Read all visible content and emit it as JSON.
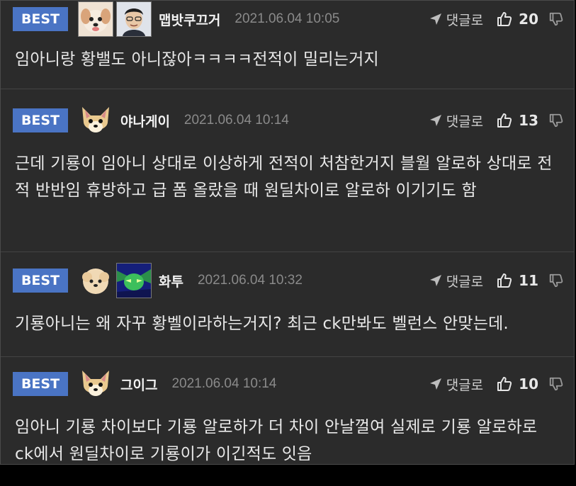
{
  "comments": [
    {
      "badge": "BEST",
      "nickname": "맵밧쿠끄거",
      "date": "2021.06.04 10:05",
      "reply_label": "댓글로",
      "likes": "20",
      "text": "임아니랑 황밸도 아니잖아ㅋㅋㅋㅋ전적이 밀리는거지"
    },
    {
      "badge": "BEST",
      "nickname": "야나게이",
      "date": "2021.06.04 10:14",
      "reply_label": "댓글로",
      "likes": "13",
      "text": "근데 기룡이 임아니 상대로 이상하게 전적이 처참한거지 블월 알로하 상대로 전적 반반임 휴방하고 급 폼 올랐을 때 원딜차이로 알로하 이기기도 함"
    },
    {
      "badge": "BEST",
      "nickname": "화투",
      "date": "2021.06.04 10:32",
      "reply_label": "댓글로",
      "likes": "11",
      "text": "기룡아니는 왜 자꾸 황벨이라하는거지? 최근 ck만봐도 벨런스 안맞는데."
    },
    {
      "badge": "BEST",
      "nickname": "그이그",
      "date": "2021.06.04 10:14",
      "reply_label": "댓글로",
      "likes": "10",
      "text": "임아니 기룡 차이보다 기룡 알로하가 더 차이 안날껄여 실제로 기룡 알로하로 ck에서 원딜차이로 기룡이가 이긴적도 잇음"
    }
  ],
  "colors": {
    "badge": "#4a74c4",
    "background": "#2b2b2b",
    "date": "#8a8a8a"
  },
  "icons": {
    "reply": "send-arrow-icon",
    "like": "thumbs-up-icon",
    "dislike": "thumbs-down-icon"
  }
}
